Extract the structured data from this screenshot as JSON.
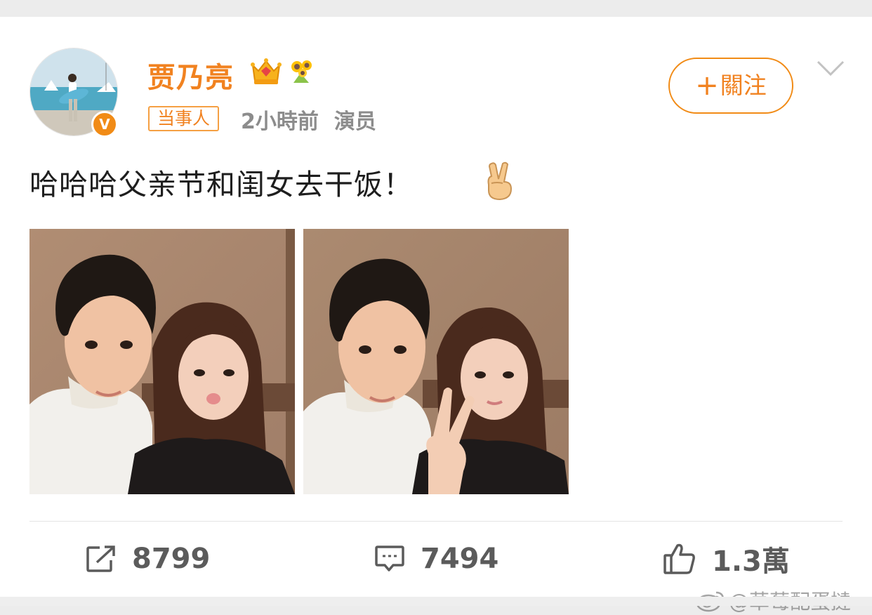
{
  "post": {
    "author": {
      "name": "贾乃亮",
      "verified_badge": "V",
      "badges": [
        "crown-icon",
        "sunflower-icon"
      ]
    },
    "tag": "当事人",
    "time": "2小時前",
    "source": "演员",
    "follow_label": "關注",
    "text": "哈哈哈父亲节和闺女去干饭！",
    "images": [
      "photo-1",
      "photo-2"
    ]
  },
  "actions": {
    "repost_count": "8799",
    "comment_count": "7494",
    "like_count": "1.3萬"
  },
  "watermark": "@草莓配蛋撻",
  "colors": {
    "accent": "#f18220",
    "text": "#1e1e1e",
    "meta": "#8c8c8c",
    "action": "#5b5b5b",
    "background": "#ececec"
  }
}
